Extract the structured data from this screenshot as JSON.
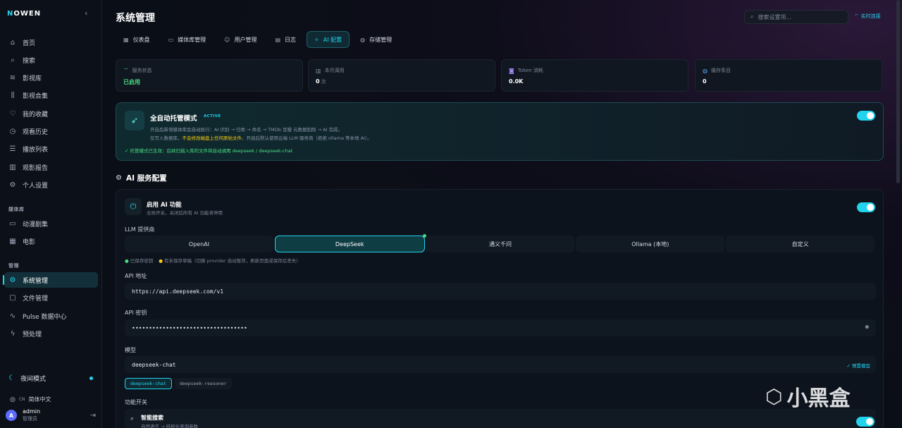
{
  "sidebar": {
    "logo_first": "N",
    "logo_rest": "OWEN",
    "items": [
      {
        "label": "首页",
        "icon": "home-icon"
      },
      {
        "label": "搜索",
        "icon": "search-icon"
      },
      {
        "label": "影视库",
        "icon": "layers-icon"
      },
      {
        "label": "影视合集",
        "icon": "library-icon"
      },
      {
        "label": "我的收藏",
        "icon": "heart-icon"
      },
      {
        "label": "观看历史",
        "icon": "clock-icon"
      },
      {
        "label": "播放列表",
        "icon": "playlist-icon"
      },
      {
        "label": "观影报告",
        "icon": "chart-icon"
      },
      {
        "label": "个人设置",
        "icon": "gear-icon"
      }
    ],
    "media_section": "媒体库",
    "media_items": [
      {
        "label": "动漫剧集",
        "icon": "tv-icon"
      },
      {
        "label": "电影",
        "icon": "film-icon"
      }
    ],
    "manage_section": "管理",
    "manage_items": [
      {
        "label": "系统管理",
        "icon": "gear-icon",
        "active": true
      },
      {
        "label": "文件管理",
        "icon": "file-icon"
      },
      {
        "label": "Pulse 数据中心",
        "icon": "pulse-icon"
      },
      {
        "label": "预处理",
        "icon": "bolt-icon"
      }
    ],
    "night_mode": "夜间模式",
    "lang_code": "CN",
    "lang": "简体中文",
    "user_initial": "A",
    "user_name": "admin",
    "user_role": "管理员"
  },
  "header": {
    "title": "系统管理",
    "search_placeholder": "搜索设置项...",
    "realtime": "实时连接"
  },
  "tabs": [
    {
      "label": "仪表盘",
      "icon": "grid-icon"
    },
    {
      "label": "媒体库管理",
      "icon": "folder-icon"
    },
    {
      "label": "用户管理",
      "icon": "users-icon"
    },
    {
      "label": "日志",
      "icon": "document-icon"
    },
    {
      "label": "AI 配置",
      "icon": "sparkle-icon",
      "active": true
    },
    {
      "label": "存储管理",
      "icon": "database-icon"
    }
  ],
  "stats": [
    {
      "label": "服务状态",
      "value": "已启用",
      "unit": "",
      "icon": "wifi-icon"
    },
    {
      "label": "本月调用",
      "value": "0",
      "unit": "次",
      "icon": "chart-icon"
    },
    {
      "label": "Token 消耗",
      "value": "0.0K",
      "unit": "",
      "icon": "cpu-icon"
    },
    {
      "label": "缓存条目",
      "value": "0",
      "unit": "",
      "icon": "database-icon"
    }
  ],
  "auto": {
    "title": "全自动托管模式",
    "badge": "ACTIVE",
    "desc1": "开启后新增媒体库会自动执行：AI 识别 → 归类 → 命名 → TMDb 豆瓣 元数据刮削 → AI 完成。",
    "desc2_pre": "仅写入数据库，",
    "desc2_hl": "不会修改磁盘上任何原始文件",
    "desc2_post": "。开启后默认使用云端 LLM 服务商（拒绝 ollama 等本地 AI）。",
    "status": "✓  托管模式已生效：后续扫描入库的文件将自动调用 deepseek / deepseek-chat"
  },
  "ai_section_title": "AI 服务配置",
  "ai": {
    "enable_title": "启用 AI 功能",
    "enable_sub": "全局开关，关闭后所有 AI 功能将停用",
    "llm_label": "LLM 提供商",
    "providers": [
      "OpenAI",
      "DeepSeek",
      "通义千问",
      "Ollama (本地)",
      "自定义"
    ],
    "hint_saved": "已保存密钥",
    "hint_unsaved": "有未保存草稿（切换 provider 自动暂存，刷新页面或保存后丢失）",
    "api_url_label": "API 地址",
    "api_url": "https://api.deepseek.com/v1",
    "api_key_label": "API 密钥",
    "api_key_masked": "••••••••••••••••••••••••••••••••••",
    "model_label": "模型",
    "model": "deepseek-chat",
    "preset": "✓ 预置模型",
    "models": [
      "deepseek-chat",
      "deepseek-reasoner"
    ],
    "features_label": "功能开关",
    "feature_title": "智能搜索",
    "feature_sub": "自然语言 → 结构化查询参数"
  },
  "watermark": "小黑盒",
  "colors": {
    "accent": "#22d3ee",
    "success": "#4ade80",
    "warning": "#facc15"
  }
}
